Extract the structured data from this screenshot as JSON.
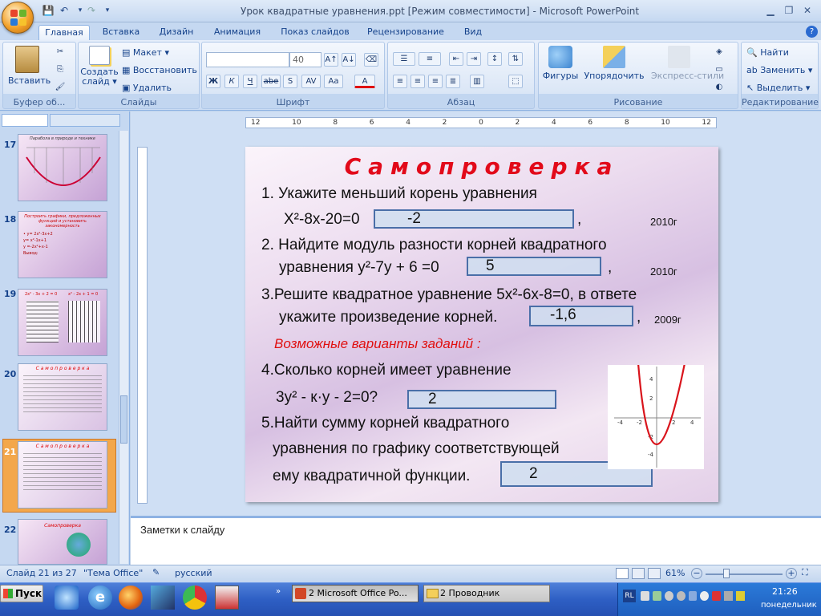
{
  "window": {
    "title": "Урок квадратные уравнения.ppt [Режим совместимости] - Microsoft PowerPoint"
  },
  "tabs": [
    "Главная",
    "Вставка",
    "Дизайн",
    "Анимация",
    "Показ слайдов",
    "Рецензирование",
    "Вид"
  ],
  "ribbon": {
    "clipboard": {
      "label": "Буфер об...",
      "paste": "Вставить"
    },
    "slides": {
      "label": "Слайды",
      "new_slide": "Создать слайд ▾",
      "layout": "Макет ▾",
      "reset": "Восстановить",
      "delete": "Удалить"
    },
    "font": {
      "label": "Шрифт",
      "font_name": "",
      "font_size": "40",
      "buttons": [
        "Ж",
        "К",
        "Ч",
        "abe",
        "S",
        "AV",
        "Aa",
        "A"
      ]
    },
    "paragraph": {
      "label": "Абзац"
    },
    "drawing": {
      "label": "Рисование",
      "shapes": "Фигуры",
      "arrange": "Упорядочить",
      "quick_styles": "Экспресс-стили"
    },
    "editing": {
      "label": "Редактирование",
      "find": "Найти",
      "replace": "Заменить ▾",
      "select": "Выделить ▾"
    }
  },
  "thumbnails": [
    {
      "num": "17",
      "title": "Парабола в природе и технике"
    },
    {
      "num": "18",
      "title": "Построить графики, предложенных функций и установить закономерность",
      "lines": [
        "• y= 2x²-3x+2",
        "  y= x²-1x+1",
        "  y =-2x²+x-1",
        "   Вывод:"
      ]
    },
    {
      "num": "19",
      "title1": "2x² - 3x + 2 = 0",
      "title2": "x² - 2x + 1 = 0"
    },
    {
      "num": "20",
      "title": "С а м о п р о в е р к а"
    },
    {
      "num": "21",
      "title": "С а м о п р о в е р к а"
    },
    {
      "num": "22",
      "title": "Самопроверка"
    }
  ],
  "ruler": {
    "h_labels": [
      "12",
      "10",
      "8",
      "6",
      "4",
      "2",
      "0",
      "2",
      "4",
      "6",
      "8",
      "10",
      "12"
    ]
  },
  "slide": {
    "title": "Самопроверка",
    "q1_line1": "1.  Укажите меньший корень уравнения",
    "q1_line2": "X²-8x-20=0",
    "q1_answer": "-2",
    "q1_year": "2010г",
    "q2_line1": "2. Найдите модуль разности корней квадратного",
    "q2_line2": "уравнения  y²-7y + 6 =0",
    "q2_answer": "5",
    "q2_year": "2010г",
    "q3_line1": "3.Решите квадратное уравнение  5x²-6x-8=0, в ответе",
    "q3_line2": "укажите произведение  корней.",
    "q3_answer": "-1,6",
    "q3_year": "2009г",
    "variants": "Возможные варианты заданий :",
    "q4_line1": "4.Сколько корней имеет уравнение",
    "q4_line2": "3y² -  к·y - 2=0?",
    "q4_answer": "2",
    "q5_line1": "5.Найти сумму корней квадратного",
    "q5_line2": "уравнения по графику соответствующей",
    "q5_line3": "ему квадратичной функции.",
    "q5_answer": "2",
    "comma": ","
  },
  "graph": {
    "x_ticks": [
      "-4",
      "-2",
      "2",
      "4"
    ],
    "y_ticks": [
      "4",
      "2",
      "-2",
      "-4"
    ],
    "curve_color": "#d9141c"
  },
  "notes": {
    "placeholder": "Заметки к слайду"
  },
  "status": {
    "slide": "Слайд 21 из 27",
    "theme": "\"Тема Office\"",
    "lang": "русский",
    "zoom": "61%"
  },
  "taskbar": {
    "start": "Пуск",
    "items": [
      "2 Microsoft Office Po...",
      "2 Проводник"
    ],
    "lang": "RL",
    "time": "21:26",
    "day": "понедельник"
  }
}
